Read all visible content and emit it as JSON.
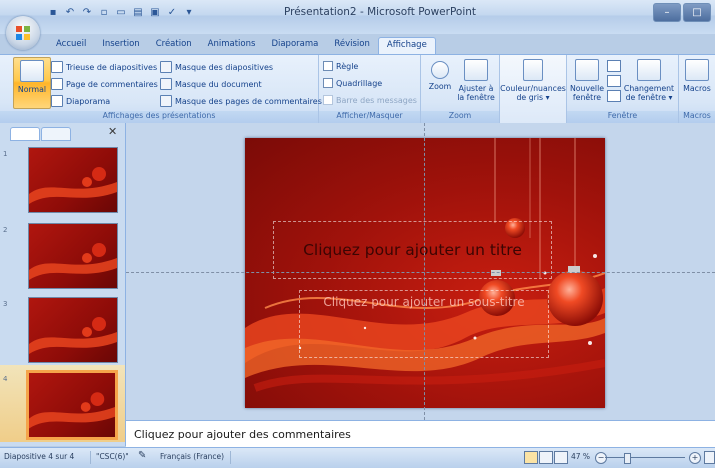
{
  "app": {
    "title": "Présentation2 - Microsoft PowerPoint"
  },
  "qat": {
    "icons": [
      "save-icon",
      "undo-icon",
      "redo-icon",
      "new-icon",
      "open-icon",
      "print-icon",
      "preview-icon",
      "spelling-icon",
      "dropdown-icon"
    ]
  },
  "tabs": [
    {
      "label": "Accueil"
    },
    {
      "label": "Insertion"
    },
    {
      "label": "Création"
    },
    {
      "label": "Animations"
    },
    {
      "label": "Diaporama"
    },
    {
      "label": "Révision"
    },
    {
      "label": "Affichage",
      "active": true
    }
  ],
  "ribbon": {
    "views": {
      "label": "Affichages des présentations",
      "normal": "Normal",
      "sorter": "Trieuse de diapositives",
      "notes_page": "Page de commentaires",
      "slideshow": "Diaporama",
      "slide_master": "Masque des diapositives",
      "handout_master": "Masque du document",
      "notes_master": "Masque des pages de commentaires"
    },
    "show": {
      "label": "Afficher/Masquer",
      "ruler": "Règle",
      "grid": "Quadrillage",
      "message_bar": "Barre des messages"
    },
    "zoom": {
      "label": "Zoom",
      "zoom": "Zoom",
      "fit_1": "Ajuster à",
      "fit_2": "la fenêtre"
    },
    "color": {
      "line1": "Couleur/nuances",
      "line2": "de gris"
    },
    "window": {
      "label": "Fenêtre",
      "new_1": "Nouvelle",
      "new_2": "fenêtre",
      "switch_1": "Changement",
      "switch_2": "de fenêtre"
    },
    "macros": {
      "label": "Macros",
      "button": "Macros"
    }
  },
  "slides": [
    {
      "number": "1"
    },
    {
      "number": "2"
    },
    {
      "number": "3"
    },
    {
      "number": "4",
      "selected": true
    }
  ],
  "slide": {
    "title_placeholder": "Cliquez pour ajouter un titre",
    "subtitle_placeholder": "Cliquez pour ajouter un sous-titre"
  },
  "notes": {
    "placeholder": "Cliquez pour ajouter des commentaires"
  },
  "status": {
    "slide_info": "Diapositive 4 sur 4",
    "theme": "\"CSC(6)\"",
    "language": "Français (France)",
    "zoom": "47 %"
  },
  "colors": {
    "accent": "#ffc84a",
    "slide_bg": "#a0120b",
    "ribbon_bg": "#dbe8f7"
  }
}
